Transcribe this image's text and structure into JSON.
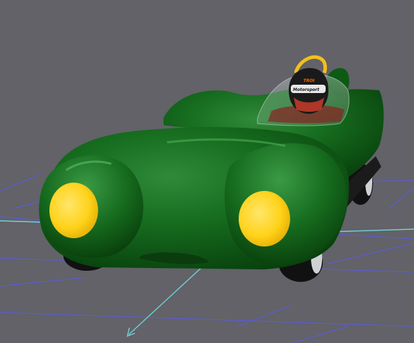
{
  "viewport": {
    "background": "#626268",
    "grid_color": "#5b5bd6",
    "axis_color": "#6fd3d6"
  },
  "model": {
    "body_color": "#0f5a14",
    "headlight_color": "#ffd21a",
    "rollbar_color": "#f2c01c"
  },
  "helmet": {
    "top_text": "TROI",
    "visor_text": "Motorsport"
  }
}
